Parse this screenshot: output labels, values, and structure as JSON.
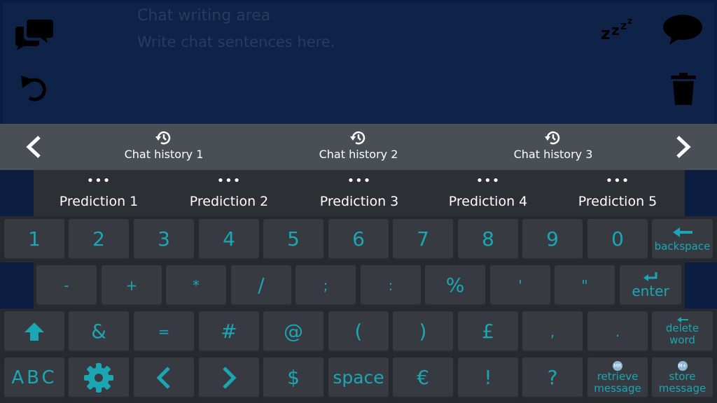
{
  "chat": {
    "placeholder_title": "Chat writing area",
    "placeholder_sub": "Write chat sentences here."
  },
  "history": {
    "items": [
      {
        "label": "Chat history 1"
      },
      {
        "label": "Chat history 2"
      },
      {
        "label": "Chat history 3"
      }
    ]
  },
  "predictions": {
    "dots": "•••",
    "items": [
      {
        "label": "Prediction 1"
      },
      {
        "label": "Prediction 2"
      },
      {
        "label": "Prediction 3"
      },
      {
        "label": "Prediction 4"
      },
      {
        "label": "Prediction 5"
      }
    ]
  },
  "keyboard": {
    "row1": [
      "1",
      "2",
      "3",
      "4",
      "5",
      "6",
      "7",
      "8",
      "9",
      "0"
    ],
    "backspace_label": "backspace",
    "row2": [
      "-",
      "+",
      "*",
      "/",
      ";",
      ":",
      "%",
      "'",
      "\""
    ],
    "enter_label": "enter",
    "row3": [
      "&",
      "=",
      "#",
      "@",
      "(",
      ")",
      "£",
      ",",
      "."
    ],
    "delete_word_line1": "delete",
    "delete_word_line2": "word",
    "abc_label": "ABC",
    "dollar": "$",
    "space_label": "space",
    "euro": "€",
    "exclaim": "!",
    "question": "?",
    "retrieve_badge": "MR",
    "retrieve_line1": "retrieve",
    "retrieve_line2": "message",
    "store_badge": "M+",
    "store_line1": "store",
    "store_line2": "message"
  },
  "colors": {
    "chat_bg": "#0f2349",
    "page_bg": "#0b1d40",
    "history_bg": "#4a4f56",
    "prediction_bg": "#2c2f33",
    "key_bg": "#373b41",
    "key_text": "#1ba6b4"
  }
}
